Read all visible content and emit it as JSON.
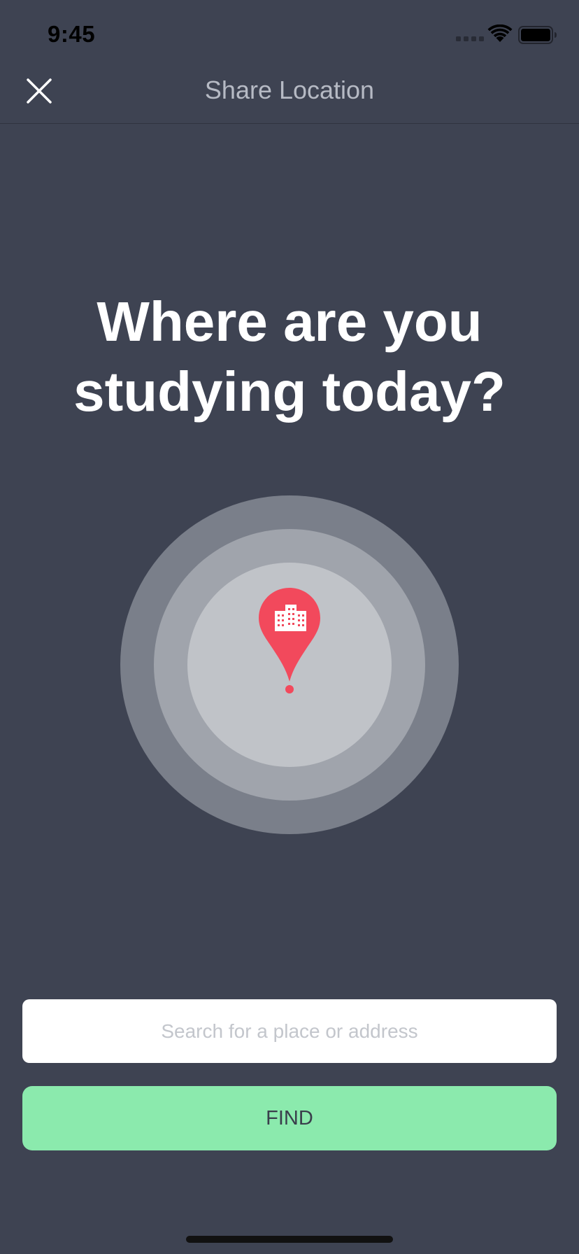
{
  "status_bar": {
    "time": "9:45"
  },
  "nav": {
    "title": "Share Location",
    "close_icon": "close-icon"
  },
  "main": {
    "headline_line1": "Where are you",
    "headline_line2": "studying today?",
    "pin_icon": "location-pin-building-icon"
  },
  "search": {
    "placeholder": "Search for a place or address",
    "value": ""
  },
  "find_button": {
    "label": "FIND"
  },
  "colors": {
    "background": "#3e4352",
    "pin": "#f2495c",
    "button": "#8beaad",
    "ring_outer": "#7a7f8a",
    "ring_middle": "#a0a4ac",
    "ring_inner": "#c0c3c8"
  }
}
